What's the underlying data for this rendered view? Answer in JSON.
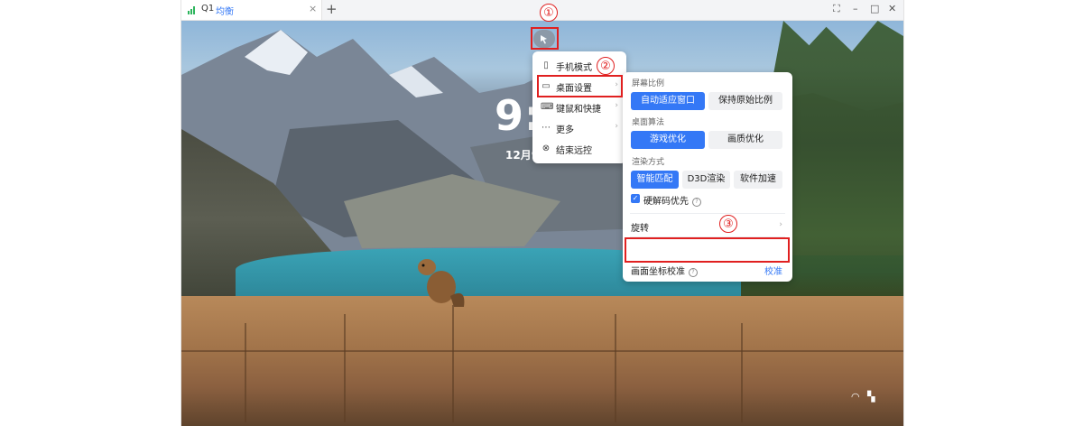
{
  "tab": {
    "title": "Q1",
    "subtitle": "均衡",
    "close": "×",
    "new_tab": "+"
  },
  "window_controls": {
    "fullscreen": "⛶",
    "minimize": "–",
    "maximize": "□",
    "close": "✕"
  },
  "desktop": {
    "clock": "9:",
    "date": "12月9"
  },
  "menu": {
    "items": [
      {
        "label": "手机模式",
        "icon": "phone-icon"
      },
      {
        "label": "桌面设置",
        "icon": "monitor-icon",
        "arrow": "›"
      },
      {
        "label": "键鼠和快捷",
        "icon": "keyboard-icon",
        "arrow": "›"
      },
      {
        "label": "更多",
        "icon": "more-icon",
        "arrow": "›"
      },
      {
        "label": "结束远控",
        "icon": "close-circle-icon"
      }
    ]
  },
  "panel": {
    "screen_ratio": {
      "label": "屏幕比例",
      "options": [
        "自动适应窗口",
        "保持原始比例"
      ],
      "selected": 0
    },
    "algorithm": {
      "label": "桌面算法",
      "options": [
        "游戏优化",
        "画质优化"
      ],
      "selected": 0
    },
    "render": {
      "label": "渲染方式",
      "options": [
        "智能匹配",
        "D3D渲染",
        "软件加速"
      ],
      "selected": 0
    },
    "hw_decode": {
      "label": "硬解码优先",
      "checked": true
    },
    "rotate": {
      "label": "旋转",
      "arrow": "›"
    },
    "calibration": {
      "label": "画面坐标校准",
      "action": "校准"
    }
  },
  "annotations": [
    "①",
    "②",
    "③"
  ],
  "colors": {
    "accent": "#3478f6",
    "annotation": "#e02020"
  }
}
